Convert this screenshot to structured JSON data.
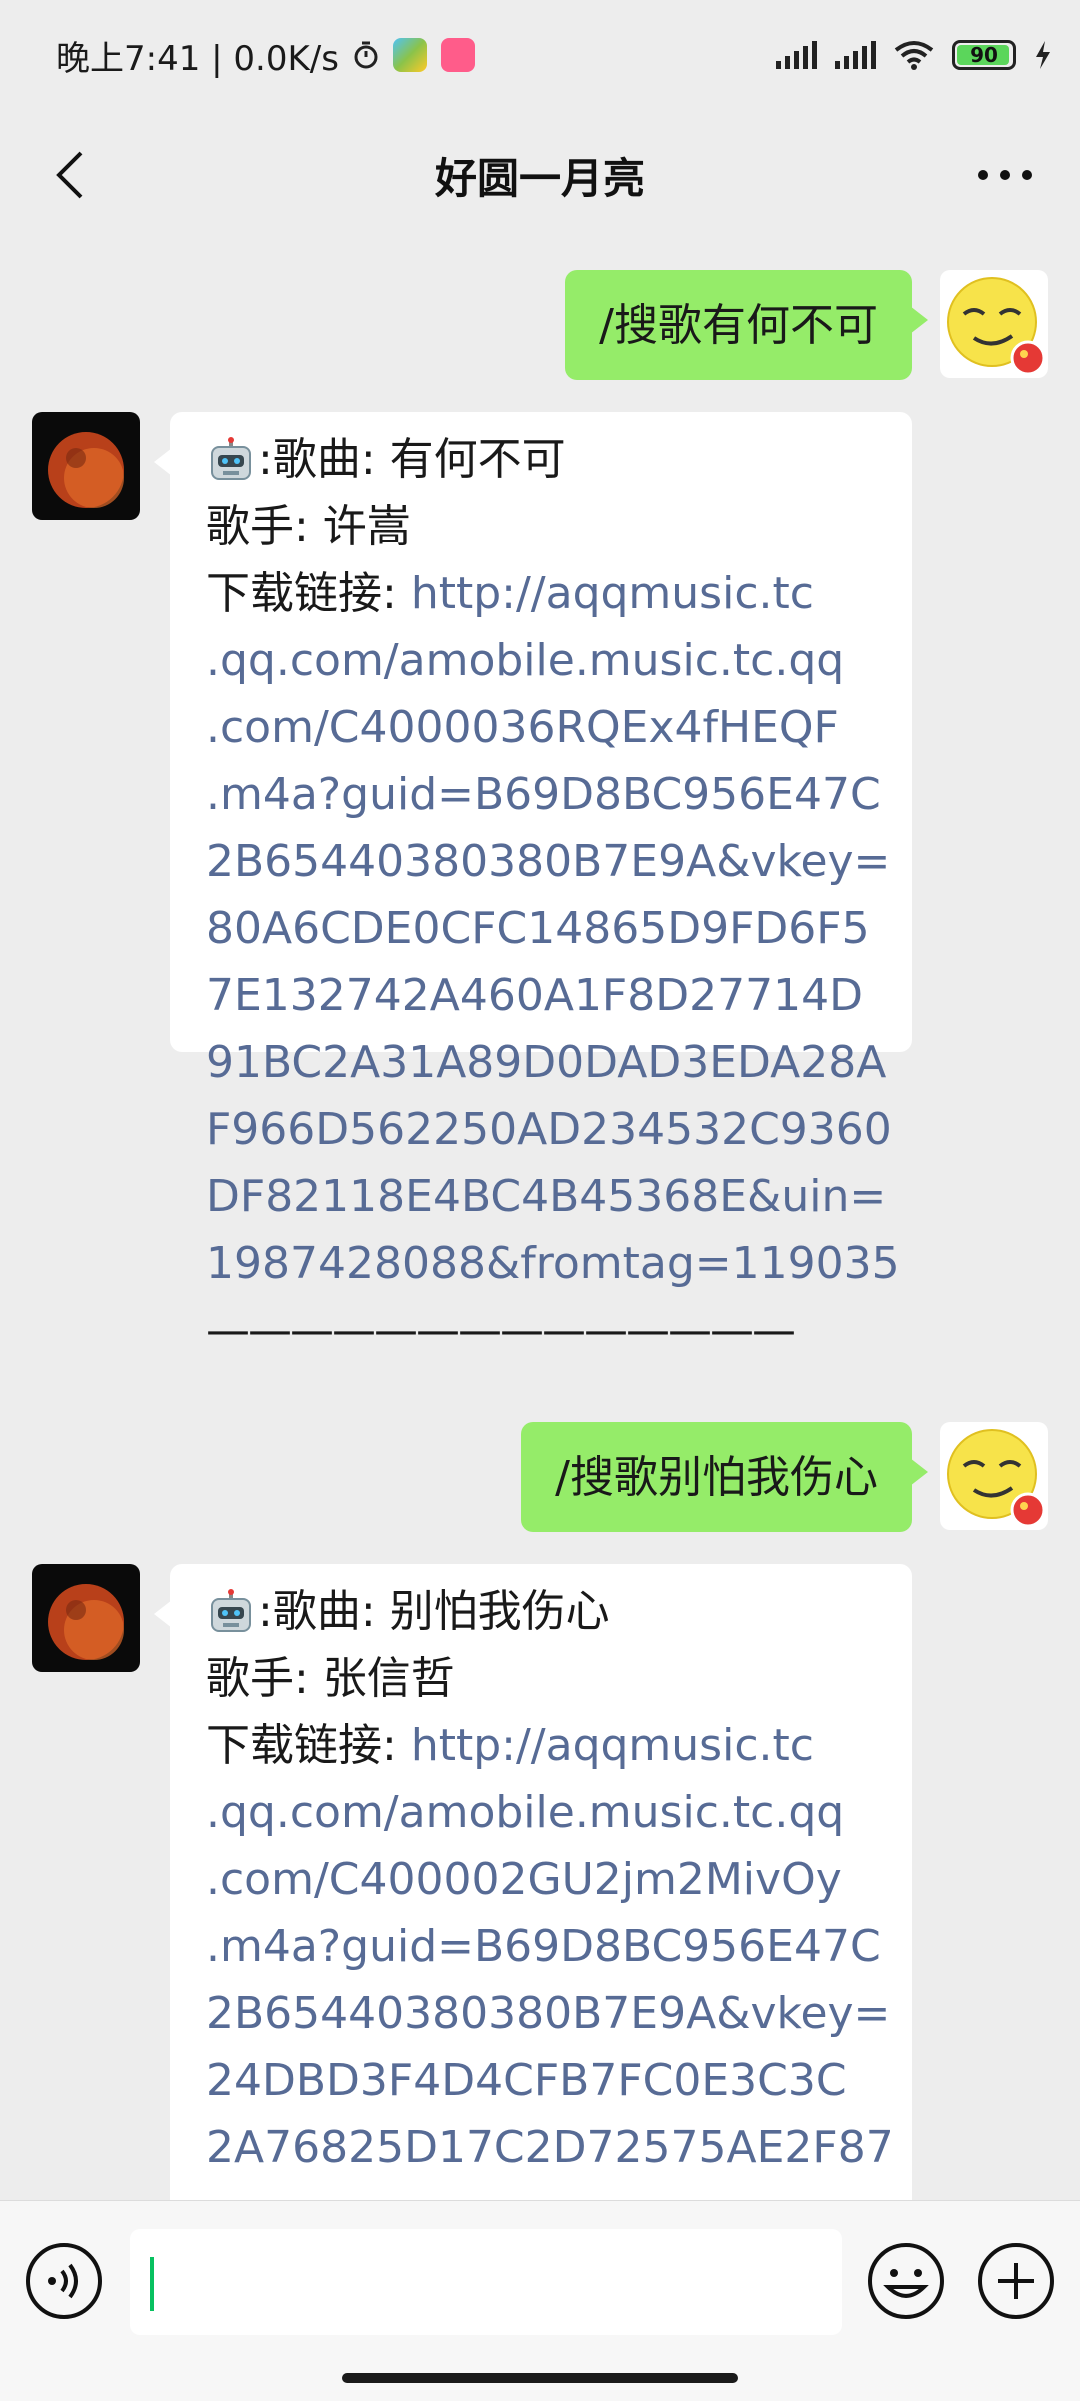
{
  "status_bar": {
    "time_text": "晚上7:41 | 0.0K/s",
    "battery_level": "90"
  },
  "header": {
    "title": "好圆一月亮"
  },
  "messages": [
    {
      "side": "me",
      "text": "/搜歌有何不可"
    },
    {
      "side": "bot",
      "song_label": ":歌曲: 有何不可",
      "singer_label": "歌手: 许嵩",
      "download_prefix": "下载链接: ",
      "link_lines": [
        "http://aqqmusic.tc",
        ".qq.com/amobile.music.tc.qq",
        ".com/C4000036RQEx4fHEQF",
        ".m4a?guid=B69D8BC956E47C",
        "2B65440380380B7E9A&vkey=",
        "80A6CDE0CFC14865D9FD6F5",
        "7E132742A460A1F8D27714D",
        "91BC2A31A89D0DAD3EDA28A",
        "F966D562250AD234532C9360",
        "DF82118E4BC4B45368E&uin=",
        "1987428088&fromtag=119035"
      ],
      "separator": "——————————————"
    },
    {
      "side": "me",
      "text": "/搜歌别怕我伤心"
    },
    {
      "side": "bot",
      "song_label": ":歌曲: 别怕我伤心",
      "singer_label": "歌手: 张信哲",
      "download_prefix": "下载链接: ",
      "link_lines": [
        "http://aqqmusic.tc",
        ".qq.com/amobile.music.tc.qq",
        ".com/C400002GU2jm2MivOy",
        ".m4a?guid=B69D8BC956E47C",
        "2B65440380380B7E9A&vkey=",
        "24DBD3F4D4CFB7FC0E3C3C",
        "2A76825D17C2D72575AE2F87"
      ]
    }
  ],
  "input_bar": {
    "voice_icon": "voice-icon",
    "emoji_icon": "emoji-icon",
    "plus_icon": "plus-icon",
    "input_value": ""
  },
  "colors": {
    "my_bubble": "#95ec69",
    "bot_bubble": "#ffffff",
    "link": "#576b95",
    "background": "#ededed"
  }
}
